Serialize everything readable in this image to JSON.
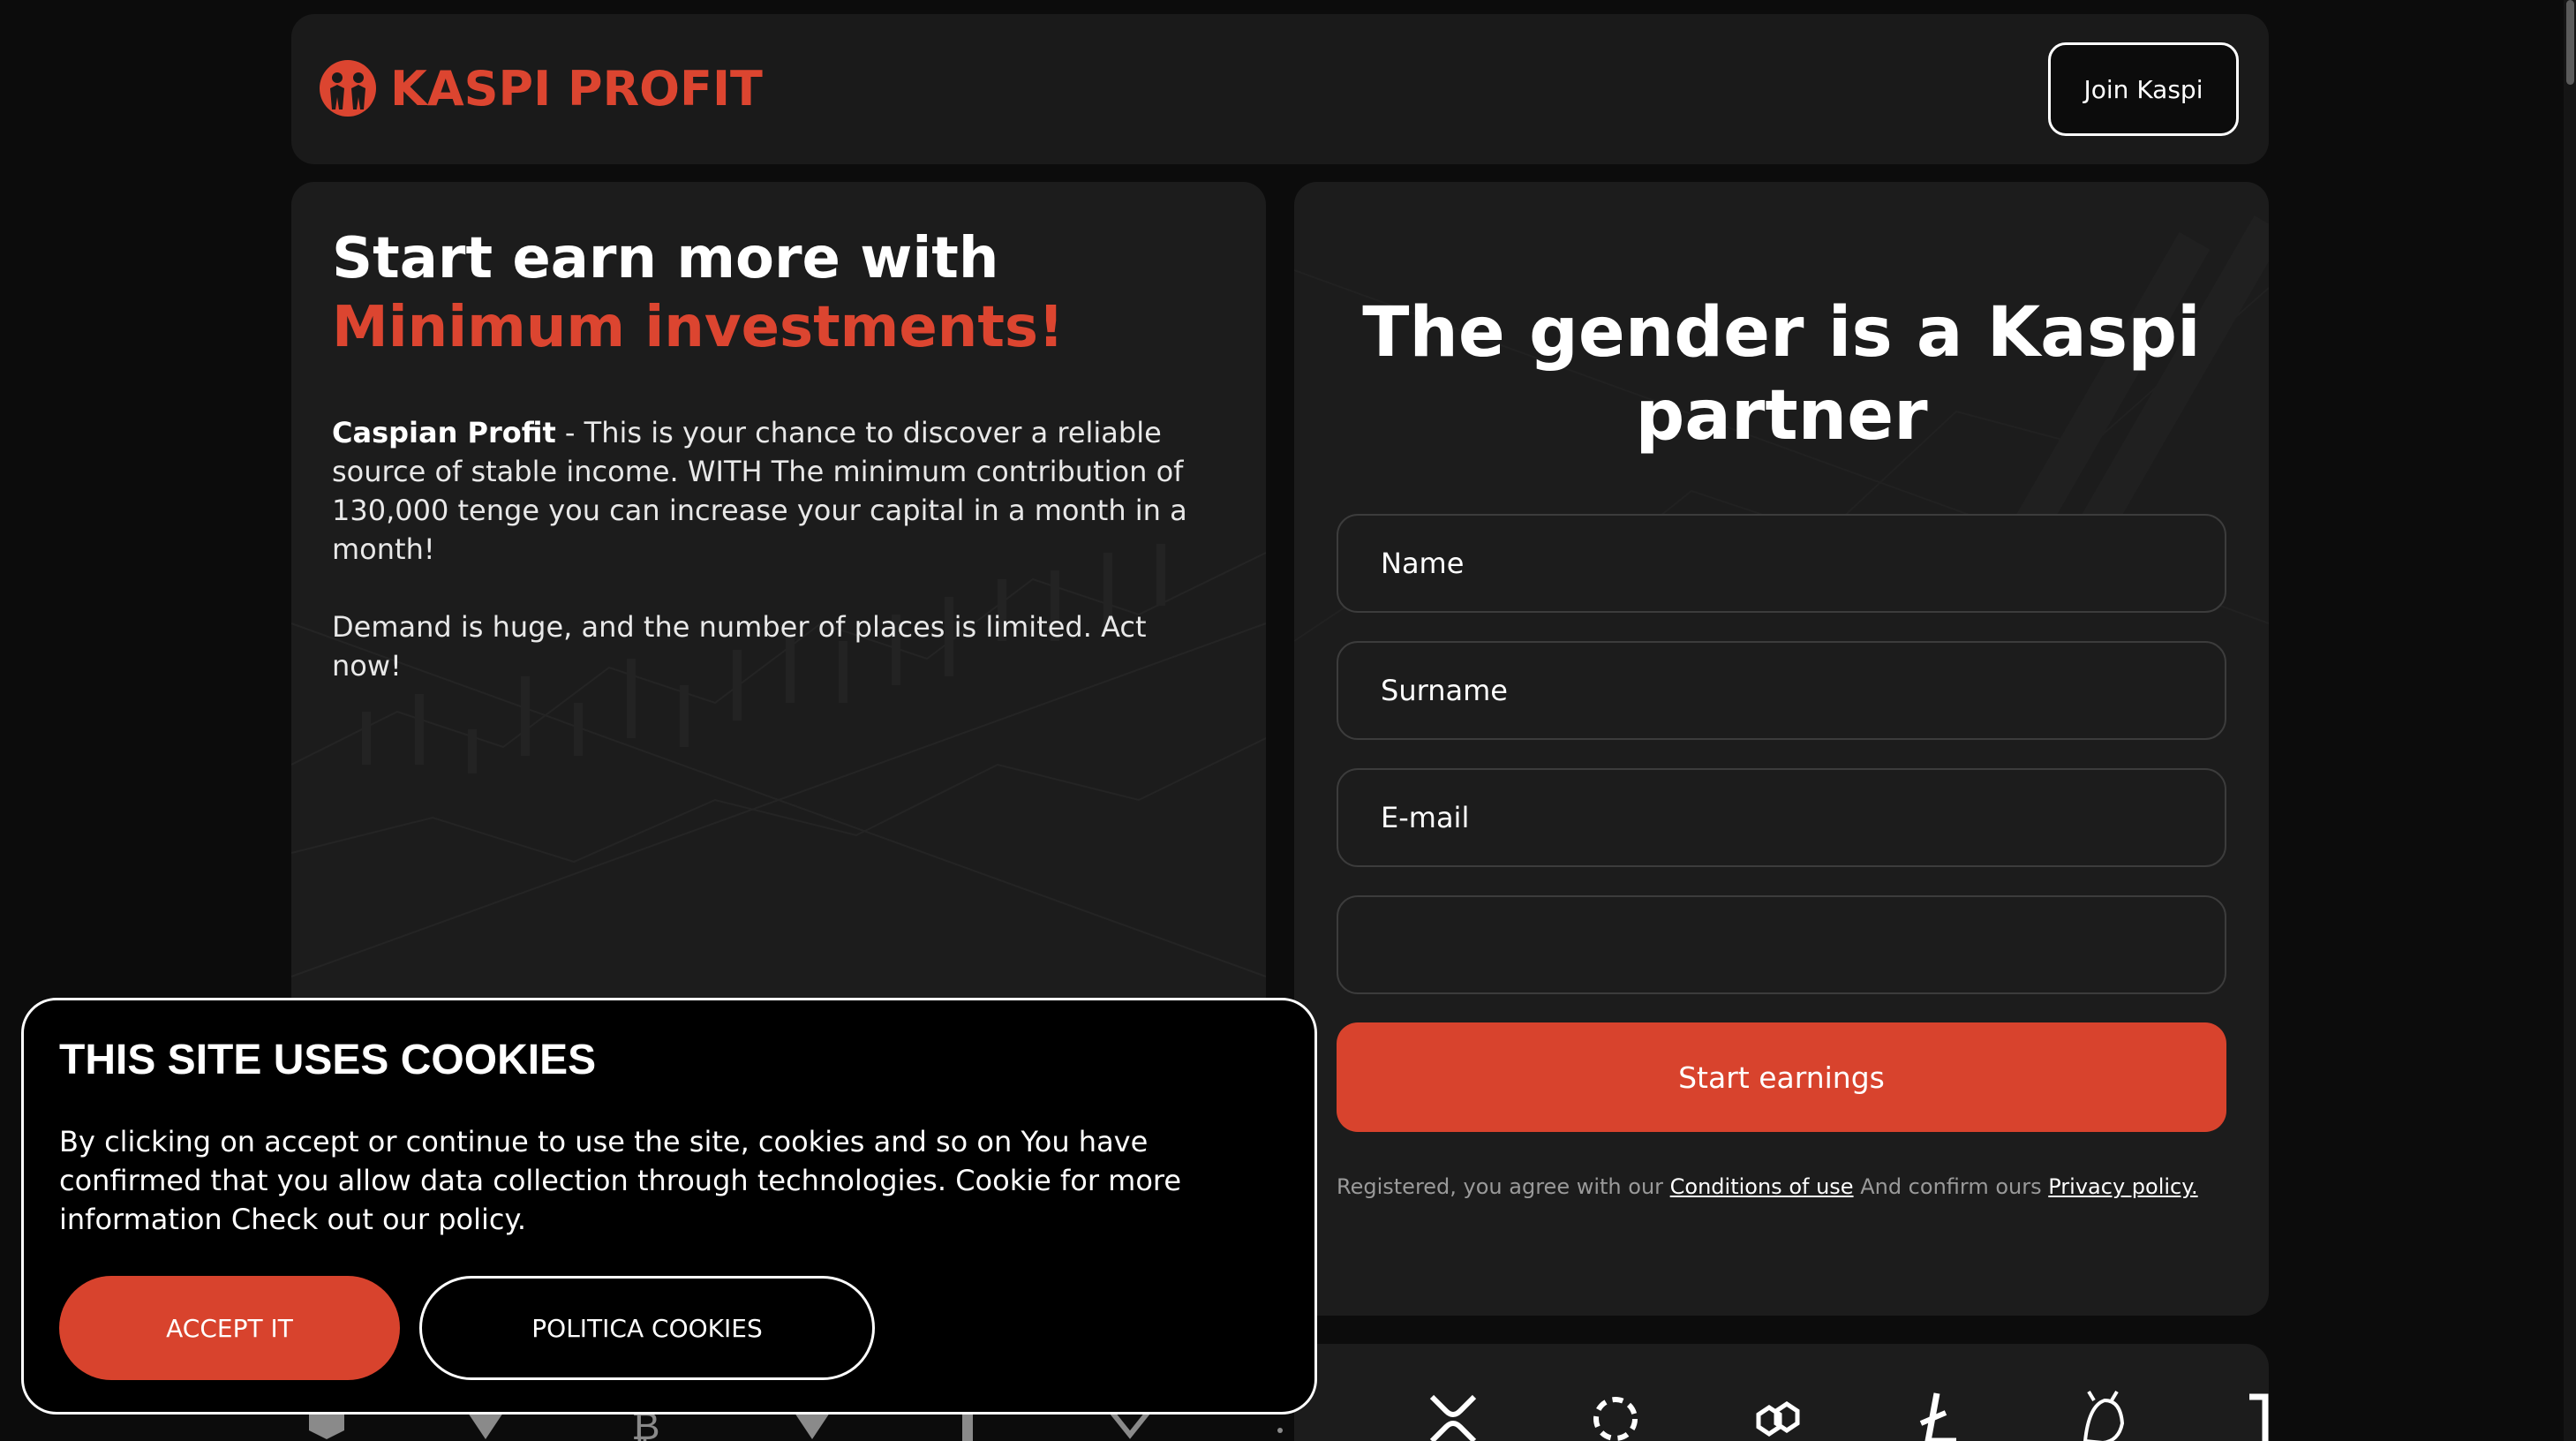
{
  "header": {
    "logo_text": "KASPI PROFIT",
    "join_label": "Join Kaspi"
  },
  "hero": {
    "headline_line1": "Start earn more with",
    "headline_line2": "Minimum investments!",
    "desc_bold": "Caspian Profit",
    "desc_rest": " - This is your chance to discover a reliable source of stable income. WITH The minimum contribution of 130,000 tenge you can increase your capital in a month in a month!",
    "desc_p2": "Demand is huge, and the number of places is limited. Act now!"
  },
  "form": {
    "title": "The gender is a Kaspi partner",
    "name_placeholder": "Name",
    "surname_placeholder": "Surname",
    "email_placeholder": "E-mail",
    "phone_placeholder": "",
    "submit_label": "Start earnings",
    "terms_prefix": "Registered, you agree with our ",
    "terms_link": "Conditions of use",
    "terms_middle": " And confirm ours ",
    "privacy_link": "Privacy policy."
  },
  "cookie": {
    "title": "THIS SITE USES COOKIES",
    "text": "By clicking on accept or continue to use the site, cookies and so on You have confirmed that you allow data collection through technologies. Cookie for more information Check out our policy.",
    "accept_label": "ACCEPT IT",
    "policy_label": "POLITICA COOKIES"
  },
  "crypto_icons": [
    "xrp-icon",
    "polkadot-icon",
    "polygon-icon",
    "litecoin-icon",
    "uniswap-icon",
    "tron-icon"
  ],
  "colors": {
    "accent": "#dc4530",
    "background": "#0c0c0c",
    "card": "#1c1c1c"
  }
}
